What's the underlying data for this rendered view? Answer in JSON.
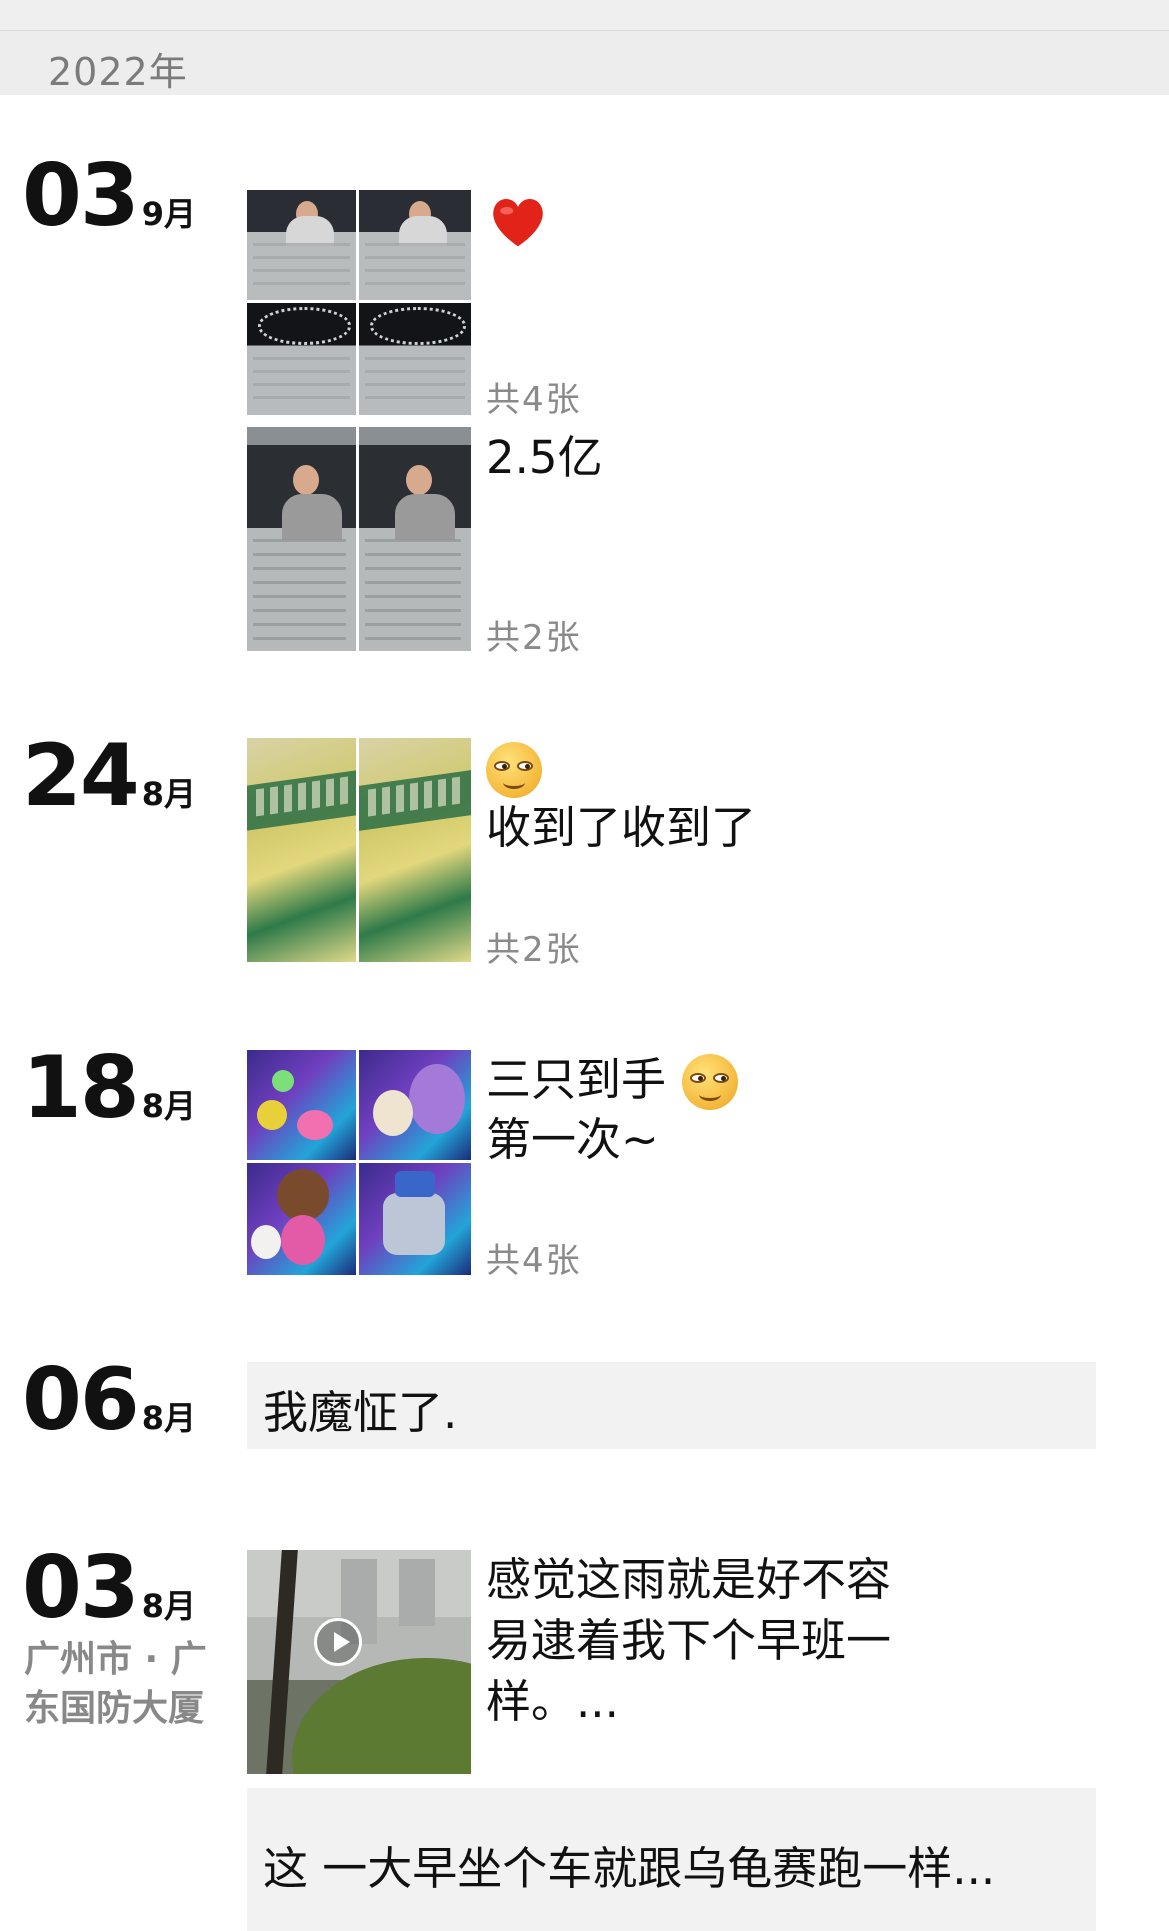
{
  "year_header": "2022年",
  "posts": [
    {
      "day": "03",
      "month": "9月",
      "items": [
        {
          "text": "❤️",
          "count": "共4张"
        },
        {
          "text": "2.5亿",
          "count": "共2张"
        }
      ]
    },
    {
      "day": "24",
      "month": "8月",
      "emoji": "grinning-face",
      "text": "收到了收到了",
      "count": "共2张"
    },
    {
      "day": "18",
      "month": "8月",
      "line1": "三只到手",
      "emoji": "grinning-face",
      "line2": "第一次~",
      "count": "共4张"
    },
    {
      "day": "06",
      "month": "8月",
      "text": "我魔怔了."
    },
    {
      "day": "03",
      "month": "8月",
      "location": "广州市 · 广东国防大厦",
      "text_lines": [
        "感觉这雨就是好不容",
        "易逮着我下个早班一",
        "样。..."
      ],
      "media": "video",
      "text_card": "这 一大早坐个车就跟乌龟赛跑一样..."
    }
  ],
  "colors": {
    "year_bg": "#ededed",
    "card_bg": "#f2f2f2",
    "muted": "#8a8a8a"
  },
  "icons": [
    "heart-icon",
    "grinning-face-icon",
    "play-icon"
  ]
}
